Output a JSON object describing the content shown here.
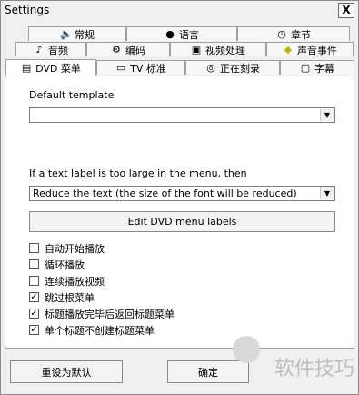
{
  "window": {
    "title": "Settings",
    "close_symbol": "X"
  },
  "tabs": {
    "row1": [
      {
        "label": "常规",
        "icon": "speaker-icon"
      },
      {
        "label": "语言",
        "icon": "globe-icon"
      },
      {
        "label": "章节",
        "icon": "clock-icon"
      }
    ],
    "row2": [
      {
        "label": "音频",
        "icon": "music-note-icon"
      },
      {
        "label": "编码",
        "icon": "gear-icon"
      },
      {
        "label": "视频处理",
        "icon": "film-icon"
      },
      {
        "label": "声音事件",
        "icon": "sound-event-icon"
      }
    ],
    "row3": [
      {
        "label": "DVD 菜单",
        "icon": "dvd-menu-icon",
        "active": true
      },
      {
        "label": "TV 标准",
        "icon": "tv-icon"
      },
      {
        "label": "正在刻录",
        "icon": "disc-icon"
      },
      {
        "label": "字幕",
        "icon": "subtitle-icon"
      }
    ]
  },
  "panel": {
    "default_template_label": "Default template",
    "default_template_value": "",
    "text_label_prompt": "If a text label is too large in the menu, then",
    "text_label_value": "Reduce the text (the size of the font will be reduced)",
    "edit_button": "Edit DVD menu labels",
    "checkboxes": [
      {
        "label": "自动开始播放",
        "checked": false
      },
      {
        "label": "循环播放",
        "checked": false
      },
      {
        "label": "连续播放视频",
        "checked": false
      },
      {
        "label": "跳过根菜单",
        "checked": true
      },
      {
        "label": "标题播放完毕后返回标题菜单",
        "checked": true
      },
      {
        "label": "单个标题不创建标题菜单",
        "checked": true
      }
    ]
  },
  "footer": {
    "reset_button": "重设为默认",
    "ok_button": "确定"
  },
  "watermark": "软件技巧"
}
